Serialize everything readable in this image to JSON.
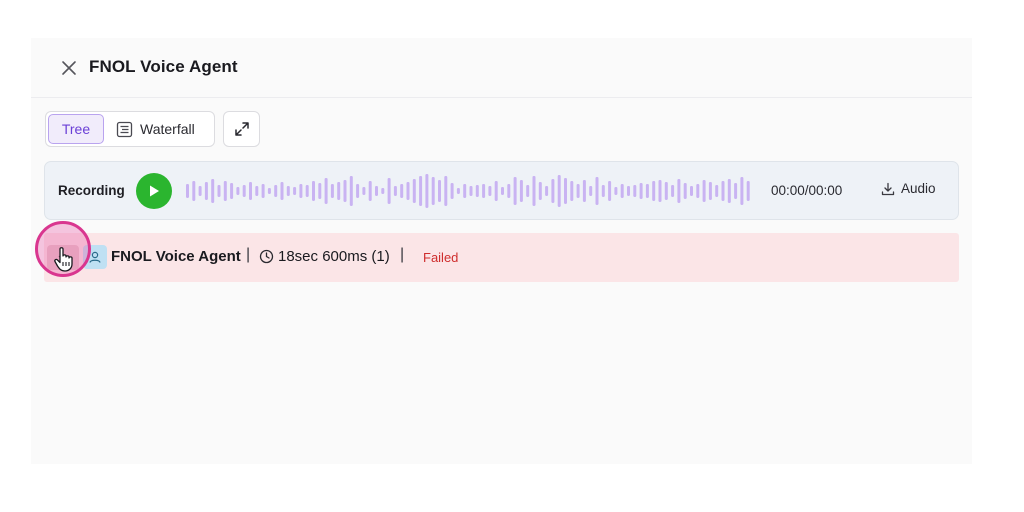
{
  "panel": {
    "title": "FNOL Voice Agent"
  },
  "view_toggle": {
    "tabs": [
      {
        "label": "Tree",
        "active": true
      },
      {
        "label": "Waterfall",
        "active": false
      }
    ]
  },
  "recording": {
    "label": "Recording",
    "time": "00:00/00:00",
    "audio_label": "Audio",
    "waveform_color": "#c9b3f2",
    "play_color": "#2bb52f"
  },
  "trace": {
    "rows": [
      {
        "name": "FNOL Voice Agent",
        "duration": "18sec 600ms (1)",
        "status": "Failed",
        "status_color": "#cf2d2d",
        "background": "#fbe5e7"
      }
    ]
  },
  "icons": {
    "close": "close-icon",
    "waterfall": "list-icon",
    "expand": "expand-icon",
    "play": "play-icon",
    "download": "download-icon",
    "agent": "agent-icon",
    "clock": "clock-icon"
  }
}
